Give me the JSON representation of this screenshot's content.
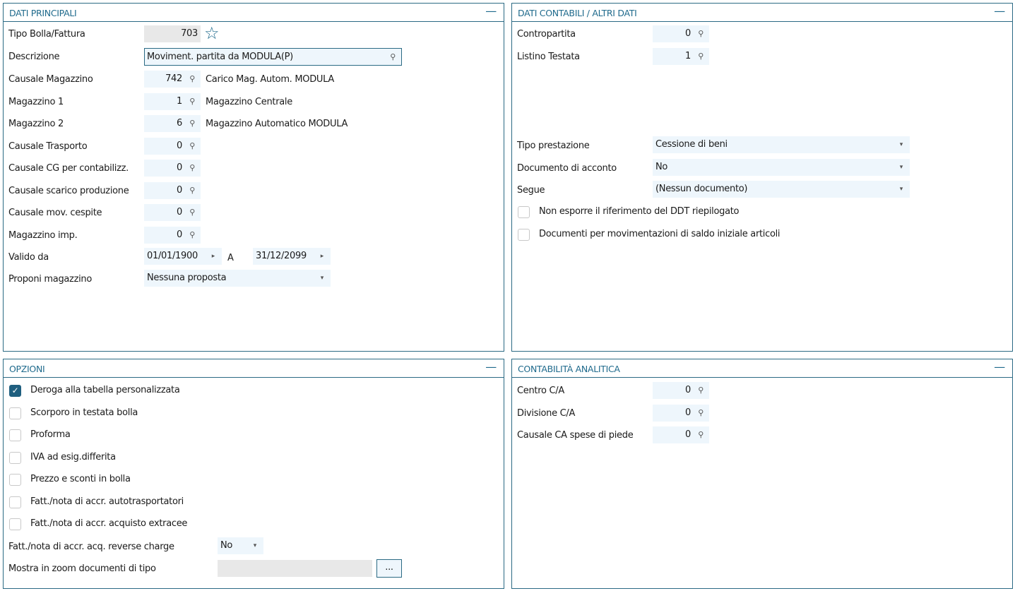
{
  "dati_principali": {
    "title": "DATI PRINCIPALI",
    "tipo_label": "Tipo Bolla/Fattura",
    "tipo_value": "703",
    "descr_label": "Descrizione",
    "descr_value": "Moviment. partita da MODULA(P)",
    "rows": [
      {
        "label": "Causale Magazzino",
        "value": "742",
        "desc": "Carico Mag. Autom. MODULA"
      },
      {
        "label": "Magazzino 1",
        "value": "1",
        "desc": "Magazzino Centrale"
      },
      {
        "label": "Magazzino 2",
        "value": "6",
        "desc": "Magazzino Automatico MODULA"
      },
      {
        "label": "Causale Trasporto",
        "value": "0",
        "desc": ""
      },
      {
        "label": "Causale CG per contabilizz.",
        "value": "0",
        "desc": ""
      },
      {
        "label": "Causale scarico produzione",
        "value": "0",
        "desc": ""
      },
      {
        "label": "Causale mov. cespite",
        "value": "0",
        "desc": ""
      },
      {
        "label": "Magazzino imp.",
        "value": "0",
        "desc": ""
      }
    ],
    "valido_label": "Valido da",
    "valido_da": "01/01/1900",
    "a_label": "A",
    "valido_a": "31/12/2099",
    "proponi_label": "Proponi magazzino",
    "proponi_value": "Nessuna proposta"
  },
  "dati_contabili": {
    "title": "DATI CONTABILI / ALTRI DATI",
    "rows": [
      {
        "label": "Contropartita",
        "value": "0"
      },
      {
        "label": "Listino Testata",
        "value": "1"
      }
    ],
    "selects": [
      {
        "label": "Tipo prestazione",
        "value": "Cessione di beni"
      },
      {
        "label": "Documento di acconto",
        "value": "No"
      },
      {
        "label": "Segue",
        "value": "(Nessun documento)"
      }
    ],
    "checks": [
      {
        "label": "Non esporre il riferimento del DDT riepilogato",
        "checked": false
      },
      {
        "label": "Documenti per movimentazioni di saldo iniziale articoli",
        "checked": false
      }
    ]
  },
  "opzioni": {
    "title": "OPZIONI",
    "checks": [
      {
        "label": "Deroga alla tabella personalizzata",
        "checked": true
      },
      {
        "label": "Scorporo in testata bolla",
        "checked": false
      },
      {
        "label": "Proforma",
        "checked": false
      },
      {
        "label": "IVA ad esig.differita",
        "checked": false
      },
      {
        "label": "Prezzo e sconti in bolla",
        "checked": false
      },
      {
        "label": "Fatt./nota di accr. autotrasportatori",
        "checked": false
      },
      {
        "label": "Fatt./nota di accr. acquisto extracee",
        "checked": false
      }
    ],
    "reverse_label": "Fatt./nota di accr. acq. reverse charge",
    "reverse_value": "No",
    "mostra_label": "Mostra in zoom documenti di tipo",
    "mostra_value": "",
    "mostra_button": "..."
  },
  "contabilita_analitica": {
    "title": "CONTABILITÀ ANALITICA",
    "rows": [
      {
        "label": "Centro C/A",
        "value": "0"
      },
      {
        "label": "Divisione C/A",
        "value": "0"
      },
      {
        "label": "Causale CA spese di piede",
        "value": "0"
      }
    ]
  },
  "icons": {
    "minimize": "—",
    "check": "✓",
    "star": "☆",
    "search": "⚲",
    "arrow_right": "▸",
    "arrow_down": "▾"
  }
}
